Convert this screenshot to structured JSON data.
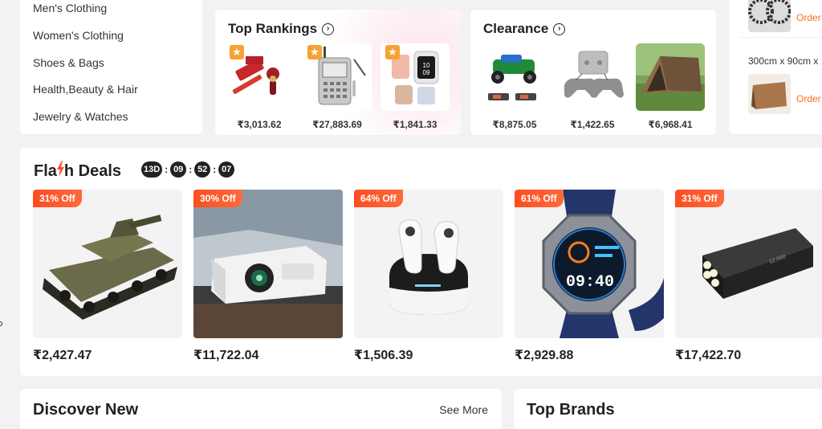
{
  "categories": {
    "items": [
      "Men's Clothing",
      "Women's Clothing",
      "Shoes & Bags",
      "Health,Beauty & Hair",
      "Jewelry & Watches"
    ]
  },
  "top_rankings": {
    "title": "Top Rankings",
    "items": [
      {
        "price": "₹3,013.62",
        "icon": "tool-kit-image"
      },
      {
        "price": "₹27,883.69",
        "icon": "signal-device-image"
      },
      {
        "price": "₹1,841.33",
        "icon": "smartwatch-image"
      }
    ]
  },
  "clearance": {
    "title": "Clearance",
    "items": [
      {
        "price": "₹8,875.05",
        "icon": "rc-truck-image"
      },
      {
        "price": "₹1,422.65",
        "icon": "game-console-image"
      },
      {
        "price": "₹6,968.41",
        "icon": "tent-image"
      }
    ]
  },
  "orders": {
    "link1": "Order",
    "size_text": "300cm x 90cm x",
    "link2": "Order"
  },
  "flash_deals": {
    "title_before": "Fla",
    "title_after": "h Deals",
    "countdown": [
      "13D",
      "09",
      "52",
      "07"
    ],
    "items": [
      {
        "off": "31% Off",
        "price": "₹2,427.47",
        "icon": "toy-tank-image"
      },
      {
        "off": "30% Off",
        "price": "₹11,722.04",
        "icon": "projector-image"
      },
      {
        "off": "64% Off",
        "price": "₹1,506.39",
        "icon": "earbuds-image"
      },
      {
        "off": "61% Off",
        "price": "₹2,929.88",
        "icon": "smartwatch-image"
      },
      {
        "off": "31% Off",
        "price": "₹17,422.70",
        "icon": "flashlight-image"
      }
    ]
  },
  "discover": {
    "title": "Discover New",
    "see_more": "See More"
  },
  "brands": {
    "title": "Top Brands"
  },
  "colors": {
    "accent": "#fd4d1f",
    "order_link": "#fd6a1f",
    "star": "#f7a233",
    "background": "#f2f2f2"
  }
}
